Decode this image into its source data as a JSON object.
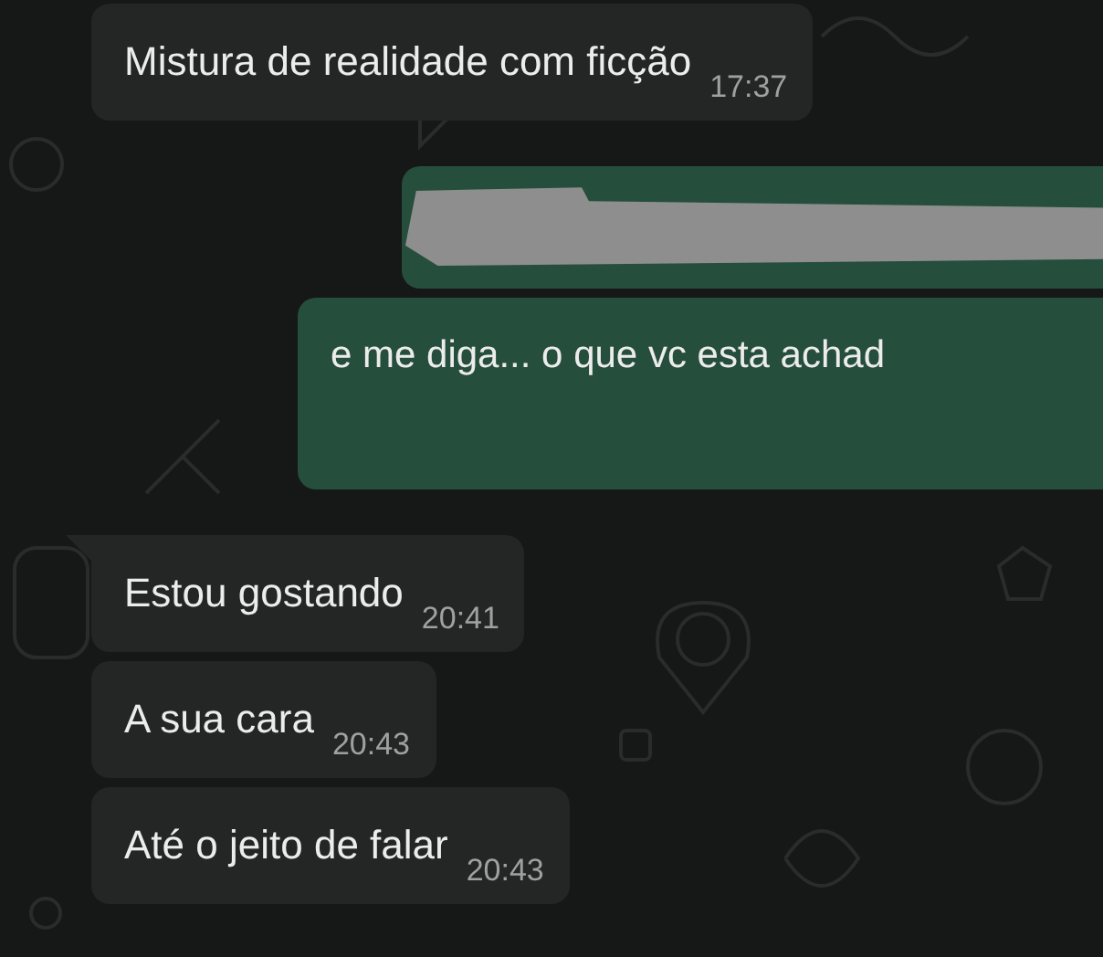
{
  "messages": [
    {
      "kind": "incoming",
      "text": "Mistura de realidade com ficção",
      "time": "17:37",
      "tail": false
    },
    {
      "kind": "outgoing",
      "text": "e me diga... o que vc esta achad",
      "redacted": true
    },
    {
      "kind": "incoming",
      "text": "Estou gostando",
      "time": "20:41",
      "tail": true
    },
    {
      "kind": "incoming",
      "text": "A sua cara",
      "time": "20:43",
      "tail": false
    },
    {
      "kind": "incoming",
      "text": "Até o jeito de falar",
      "time": "20:43",
      "tail": false
    }
  ]
}
